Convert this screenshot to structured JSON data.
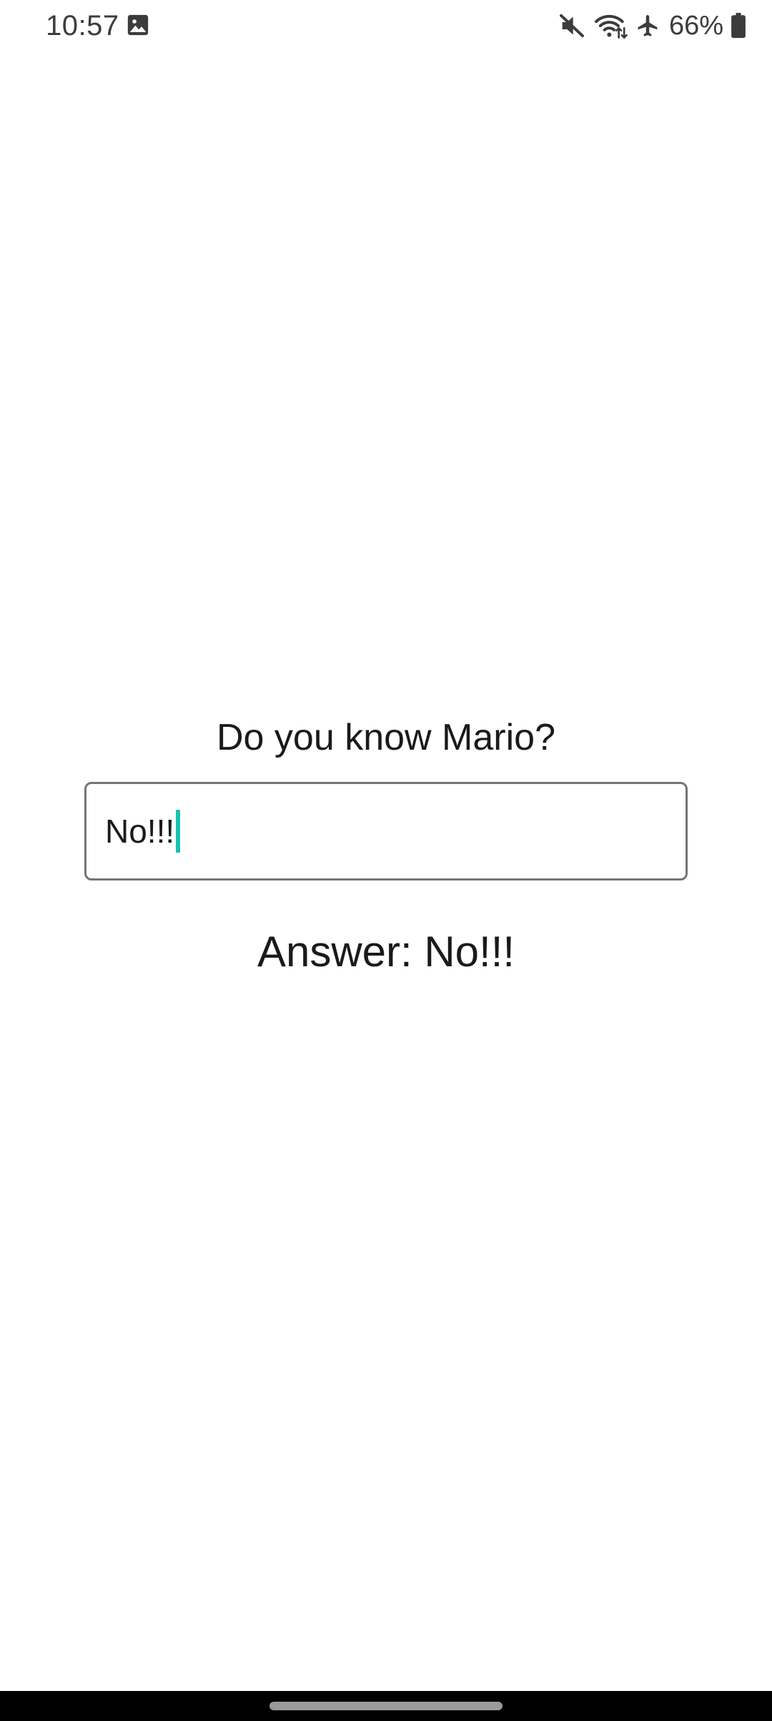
{
  "status_bar": {
    "time": "10:57",
    "battery_percent": "66%",
    "icons": [
      "gallery-icon",
      "mute-icon",
      "wifi-icon",
      "airplane-mode-icon",
      "battery-icon"
    ]
  },
  "main": {
    "question": "Do you know Mario?",
    "input_value": "No!!!",
    "answer_text": "Answer: No!!!"
  },
  "colors": {
    "cursor": "#19c1b0",
    "field_border": "#747474",
    "text": "#1a1a1a",
    "nav_bar": "#000000"
  }
}
